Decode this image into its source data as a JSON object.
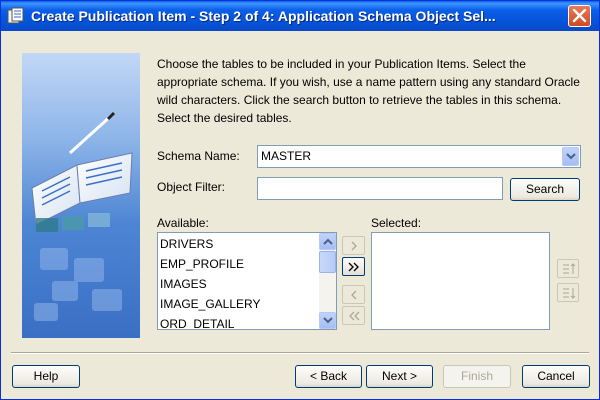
{
  "window": {
    "title": "Create Publication Item - Step 2 of 4: Application Schema Object Sel..."
  },
  "instructions": "Choose the tables to be included in your Publication Items. Select the appropriate schema. If you wish, use a name pattern using any standard Oracle wild characters. Click the search button to retrieve the tables in this schema. Select the desired tables.",
  "form": {
    "schema_label": "Schema Name:",
    "schema_value": "MASTER",
    "filter_label": "Object Filter:",
    "filter_value": "",
    "search_label": "Search"
  },
  "available": {
    "label": "Available:",
    "items": [
      "DRIVERS",
      "EMP_PROFILE",
      "IMAGES",
      "IMAGE_GALLERY",
      "ORD_DETAIL"
    ]
  },
  "selected": {
    "label": "Selected:",
    "items": []
  },
  "buttons": {
    "help": "Help",
    "back": "< Back",
    "next": "Next >",
    "finish": "Finish",
    "cancel": "Cancel"
  },
  "colors": {
    "titlebar": "#0a5fe8",
    "window_bg": "#ece9d8",
    "input_border": "#7f9db9",
    "close_button": "#d24a23"
  },
  "icons": {
    "app": "publication-app-icon",
    "close": "close-icon",
    "combo_arrow": "chevron-down-icon",
    "move_right": "move-right-icon",
    "move_all_right": "move-all-right-icon",
    "move_left": "move-left-icon",
    "move_all_left": "move-all-left-icon",
    "move_up": "move-up-icon",
    "move_down": "move-down-icon"
  }
}
